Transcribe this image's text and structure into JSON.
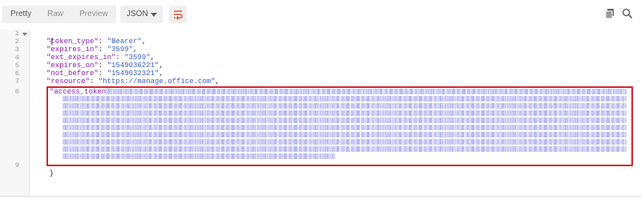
{
  "toolbar": {
    "tabs": [
      {
        "label": "Pretty",
        "active": true
      },
      {
        "label": "Raw",
        "active": false
      },
      {
        "label": "Preview",
        "active": false
      }
    ],
    "format": "JSON",
    "wrap_icon": "wrap-lines-icon",
    "copy_icon": "copy-icon",
    "search_icon": "search-icon"
  },
  "editor": {
    "line_numbers": [
      "1",
      "2",
      "3",
      "4",
      "5",
      "6",
      "7",
      "8",
      "9"
    ],
    "open_brace": "{",
    "close_brace": "}",
    "lines": [
      {
        "key": "\"token_type\"",
        "sep": ": ",
        "value": "\"Bearer\"",
        "end": ","
      },
      {
        "key": "\"expires_in\"",
        "sep": ": ",
        "value": "\"3599\"",
        "end": ","
      },
      {
        "key": "\"ext_expires_in\"",
        "sep": ": ",
        "value": "\"3599\"",
        "end": ","
      },
      {
        "key": "\"expires_on\"",
        "sep": ": ",
        "value": "\"1549036221\"",
        "end": ","
      },
      {
        "key": "\"not_before\"",
        "sep": ": ",
        "value": "\"1549032321\"",
        "end": ","
      },
      {
        "key": "\"resource\"",
        "sep": ": ",
        "value": "\"https://manage.office.com\"",
        "end": ","
      },
      {
        "key": "\"access_token\"",
        "sep": ": ",
        "value": "",
        "end": ""
      }
    ]
  },
  "colors": {
    "highlight_border": "#d6222b",
    "json_key": "#8a1cab",
    "json_string": "#3b5ec4",
    "wrap_icon": "#e8502f"
  }
}
